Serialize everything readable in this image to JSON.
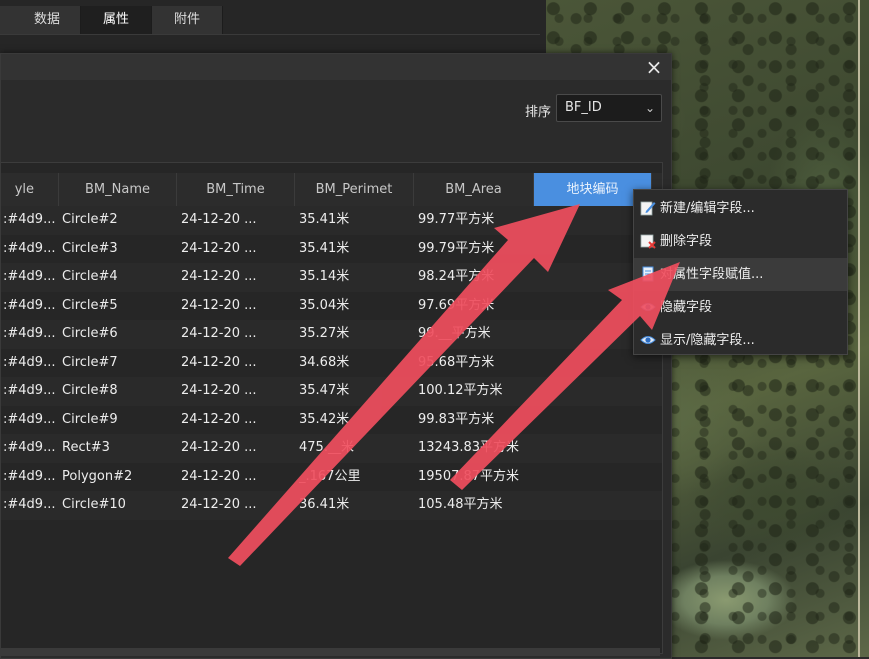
{
  "tabs": [
    {
      "label": "数据",
      "active": false
    },
    {
      "label": "属性",
      "active": true
    },
    {
      "label": "附件",
      "active": false
    }
  ],
  "dialog": {
    "close_label": "×",
    "sort": {
      "label": "排序",
      "value": "BF_ID"
    }
  },
  "table": {
    "columns": [
      "yle",
      "BM_Name",
      "BM_Time",
      "BM_Perimet",
      "BM_Area",
      "地块编码"
    ],
    "selected_column": "地块编码",
    "rows": [
      {
        "style": ":#4d9...",
        "name": "Circle#2",
        "time": "24-12-20 ...",
        "perimeter": "35.41米",
        "area": "99.77平方米"
      },
      {
        "style": ":#4d9...",
        "name": "Circle#3",
        "time": "24-12-20 ...",
        "perimeter": "35.41米",
        "area": "99.79平方米"
      },
      {
        "style": ":#4d9...",
        "name": "Circle#4",
        "time": "24-12-20 ...",
        "perimeter": "35.14米",
        "area": "98.24平方米"
      },
      {
        "style": ":#4d9...",
        "name": "Circle#5",
        "time": "24-12-20 ...",
        "perimeter": "35.04米",
        "area": "97.69平方米"
      },
      {
        "style": ":#4d9...",
        "name": "Circle#6",
        "time": "24-12-20 ...",
        "perimeter": "35.27米",
        "area": "99.__平方米"
      },
      {
        "style": ":#4d9...",
        "name": "Circle#7",
        "time": "24-12-20 ...",
        "perimeter": "34.68米",
        "area": "95.68平方米"
      },
      {
        "style": ":#4d9...",
        "name": "Circle#8",
        "time": "24-12-20 ...",
        "perimeter": "35.47米",
        "area": "100.12平方米"
      },
      {
        "style": ":#4d9...",
        "name": "Circle#9",
        "time": "24-12-20 ...",
        "perimeter": "35.42米",
        "area": "99.83平方米"
      },
      {
        "style": ":#4d9...",
        "name": "Rect#3",
        "time": "24-12-20 ...",
        "perimeter": "475.__米",
        "area": "13243.83平方米"
      },
      {
        "style": ":#4d9...",
        "name": "Polygon#2",
        "time": "24-12-20 ...",
        "perimeter": "_.167公里",
        "area": "19507.87平方米"
      },
      {
        "style": ":#4d9...",
        "name": "Circle#10",
        "time": "24-12-20 ...",
        "perimeter": "36.41米",
        "area": "105.48平方米"
      }
    ]
  },
  "context_menu": {
    "items": [
      {
        "label": "新建/编辑字段...",
        "icon": "edit-field-icon"
      },
      {
        "label": "删除字段",
        "icon": "delete-field-icon"
      },
      {
        "label": "对属性字段赋值...",
        "icon": "assign-value-icon"
      },
      {
        "label": "隐藏字段",
        "icon": "eye-icon"
      },
      {
        "label": "显示/隐藏字段...",
        "icon": "eye-icon"
      }
    ],
    "hovered_index": 2
  },
  "colors": {
    "accent": "#4a8fe0",
    "arrow": "#f04e5e"
  }
}
